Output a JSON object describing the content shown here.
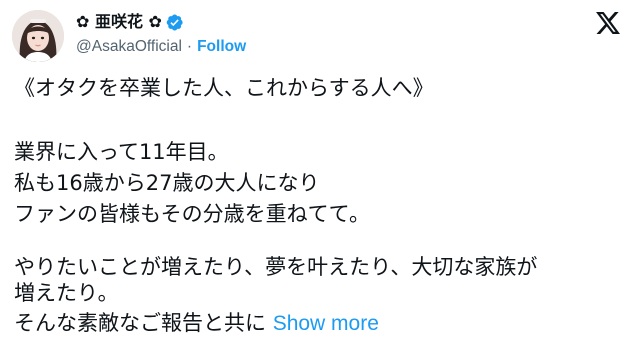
{
  "account": {
    "display_name": "✿ 亜咲花 ✿",
    "handle": "@AsakaOfficial",
    "separator": "·",
    "follow_label": "Follow",
    "verified_badge_color": "#1d9bf0"
  },
  "brand": {
    "logo_icon": "x-logo-icon"
  },
  "tweet": {
    "lines": [
      "《オタクを卒業した人、これからする人へ》",
      "業界に入って11年目。",
      "私も16歳から27歳の大人になり",
      "ファンの皆様もその分歳を重ねてて。",
      "やりたいことが増えたり、夢を叶えたり、大切な家族が",
      "増えたり。",
      "そんな素敵なご報告と共に"
    ],
    "show_more_label": "Show more"
  },
  "colors": {
    "text": "#0f1419",
    "secondary": "#536471",
    "link": "#1d9bf0"
  }
}
